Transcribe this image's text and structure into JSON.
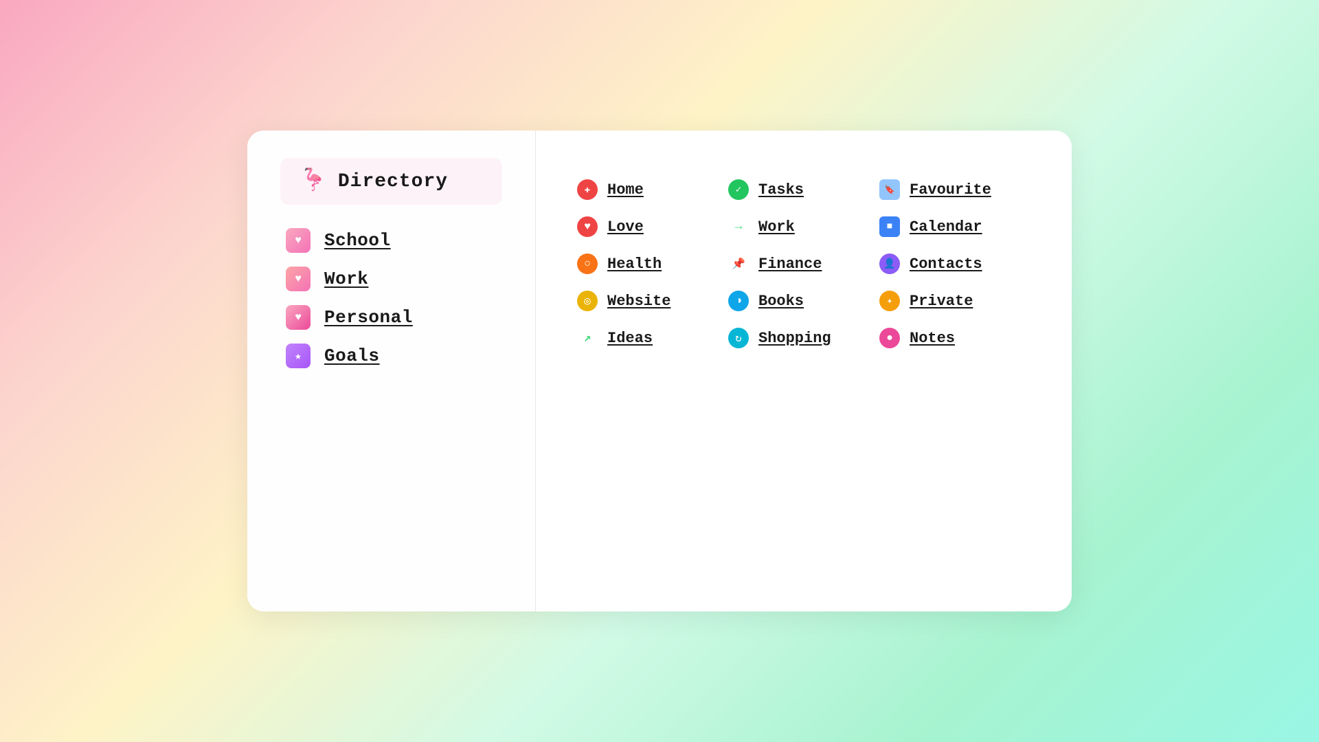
{
  "left": {
    "header": {
      "icon": "🦩",
      "title": "Directory"
    },
    "items": [
      {
        "id": "school",
        "label": "School",
        "iconClass": "icon-school",
        "iconContent": "♥"
      },
      {
        "id": "work",
        "label": "Work",
        "iconClass": "icon-work",
        "iconContent": "♥"
      },
      {
        "id": "personal",
        "label": "Personal",
        "iconClass": "icon-personal",
        "iconContent": "♥"
      },
      {
        "id": "goals",
        "label": "Goals",
        "iconClass": "icon-goals",
        "iconContent": "★"
      }
    ]
  },
  "right": {
    "col1": [
      {
        "id": "home",
        "label": "Home",
        "iconClass": "ic-home",
        "iconContent": "➕",
        "iconColor": "#ffffff"
      },
      {
        "id": "love",
        "label": "Love",
        "iconClass": "ic-love",
        "iconContent": "♥",
        "iconColor": "#ffffff"
      },
      {
        "id": "health",
        "label": "Health",
        "iconClass": "ic-health",
        "iconContent": "⊙",
        "iconColor": "#ffffff"
      },
      {
        "id": "website",
        "label": "Website",
        "iconClass": "ic-website",
        "iconContent": "◎",
        "iconColor": "#ffffff"
      },
      {
        "id": "ideas",
        "label": "Ideas",
        "iconClass": "ic-ideas",
        "iconContent": "↗",
        "iconColor": "#4ade80"
      }
    ],
    "col2": [
      {
        "id": "tasks",
        "label": "Tasks",
        "iconClass": "ic-tasks",
        "iconContent": "✔",
        "iconColor": "#ffffff"
      },
      {
        "id": "work",
        "label": "Work",
        "iconClass": "ic-work",
        "iconContent": "→",
        "iconColor": "#4ade80"
      },
      {
        "id": "finance",
        "label": "Finance",
        "iconClass": "ic-finance",
        "iconContent": "📌",
        "iconColor": "#6b7280"
      },
      {
        "id": "books",
        "label": "Books",
        "iconClass": "ic-books",
        "iconContent": "◑",
        "iconColor": "#ffffff"
      },
      {
        "id": "shopping",
        "label": "Shopping",
        "iconClass": "ic-shopping",
        "iconContent": "↻",
        "iconColor": "#ffffff"
      }
    ],
    "col3": [
      {
        "id": "favourite",
        "label": "Favourite",
        "iconClass": "ic-favourite",
        "iconContent": "🔖",
        "iconColor": "#ffffff"
      },
      {
        "id": "calendar",
        "label": "Calendar",
        "iconClass": "ic-calendar",
        "iconContent": "■",
        "iconColor": "#ffffff"
      },
      {
        "id": "contacts",
        "label": "Contacts",
        "iconClass": "ic-contacts",
        "iconContent": "👤",
        "iconColor": "#ffffff"
      },
      {
        "id": "private",
        "label": "Private",
        "iconClass": "ic-private",
        "iconContent": "✦",
        "iconColor": "#ffffff"
      },
      {
        "id": "notes",
        "label": "Notes",
        "iconClass": "ic-notes",
        "iconContent": "●",
        "iconColor": "#ffffff"
      }
    ]
  }
}
